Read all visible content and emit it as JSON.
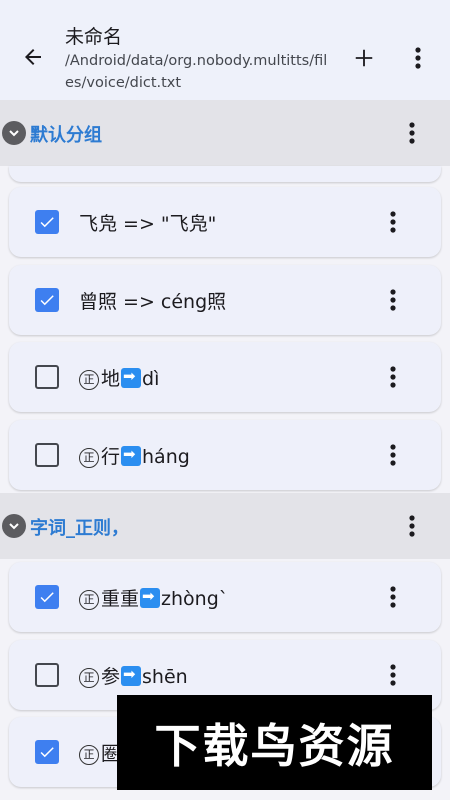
{
  "app_bar": {
    "title": "未命名",
    "subtitle": "/Android/data/org.nobody.multitts/files/voice/dict.txt",
    "icons": {
      "back": "arrow-back",
      "add": "plus",
      "overflow": "more-vert"
    }
  },
  "groups": [
    {
      "title": "默认分组",
      "items": [
        {
          "checked": true,
          "text": "飞凫 => \"飞凫\"",
          "type": "plain"
        },
        {
          "checked": true,
          "text": "曾照 => céng照",
          "type": "plain"
        },
        {
          "checked": false,
          "regex_badge": "正",
          "source": "地",
          "target": "dì",
          "type": "regex"
        },
        {
          "checked": false,
          "regex_badge": "正",
          "source": "行",
          "target": "háng",
          "type": "regex"
        }
      ]
    },
    {
      "title": "字词_正则，",
      "items": [
        {
          "checked": true,
          "regex_badge": "正",
          "source": "重重",
          "target": "zhòngˋ",
          "type": "regex"
        },
        {
          "checked": false,
          "regex_badge": "正",
          "source": "参",
          "target": "shēn",
          "type": "regex"
        },
        {
          "checked": true,
          "regex_badge": "正",
          "source": "圈",
          "target": "",
          "type": "regex"
        }
      ]
    }
  ],
  "watermark": "下载鸟资源",
  "colors": {
    "accent": "#3e7ff0",
    "group_title": "#2d7bd2",
    "arrow_emoji": "#2b8ef0"
  }
}
